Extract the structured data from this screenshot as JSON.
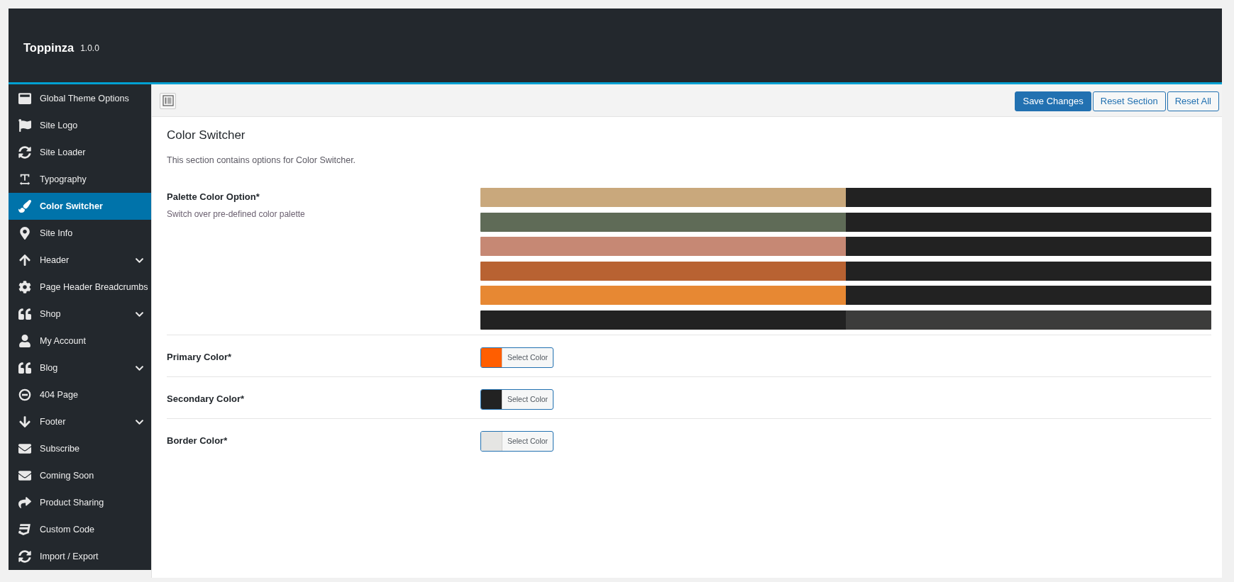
{
  "header": {
    "title": "Toppinza",
    "version": "1.0.0"
  },
  "sidebar": {
    "items": [
      {
        "label": "Global Theme Options",
        "selected": false,
        "submenu": false
      },
      {
        "label": "Site Logo",
        "selected": false,
        "submenu": false
      },
      {
        "label": "Site Loader",
        "selected": false,
        "submenu": false
      },
      {
        "label": "Typography",
        "selected": false,
        "submenu": false
      },
      {
        "label": "Color Switcher",
        "selected": true,
        "submenu": false
      },
      {
        "label": "Site Info",
        "selected": false,
        "submenu": false
      },
      {
        "label": "Header",
        "selected": false,
        "submenu": true
      },
      {
        "label": "Page Header Breadcrumbs",
        "selected": false,
        "submenu": false
      },
      {
        "label": "Shop",
        "selected": false,
        "submenu": true
      },
      {
        "label": "My Account",
        "selected": false,
        "submenu": false
      },
      {
        "label": "Blog",
        "selected": false,
        "submenu": true
      },
      {
        "label": "404 Page",
        "selected": false,
        "submenu": false
      },
      {
        "label": "Footer",
        "selected": false,
        "submenu": true
      },
      {
        "label": "Subscribe",
        "selected": false,
        "submenu": false
      },
      {
        "label": "Coming Soon",
        "selected": false,
        "submenu": false
      },
      {
        "label": "Product Sharing",
        "selected": false,
        "submenu": false
      },
      {
        "label": "Custom Code",
        "selected": false,
        "submenu": false
      },
      {
        "label": "Import / Export",
        "selected": false,
        "submenu": false
      }
    ]
  },
  "toolbar": {
    "buttons": [
      {
        "label": "Save Changes",
        "kind": "primary"
      },
      {
        "label": "Reset Section",
        "kind": "secondary"
      },
      {
        "label": "Reset All",
        "kind": "secondary"
      }
    ]
  },
  "section": {
    "title": "Color Switcher",
    "description": "This section contains options for Color Switcher."
  },
  "fields": [
    {
      "kind": "palette",
      "label": "Palette Color Option*",
      "description": "Switch over pre-defined color palette",
      "options": [
        {
          "swatches": [
            {
              "color": "#c9a87c"
            },
            {
              "color": "#222222"
            }
          ]
        },
        {
          "swatches": [
            {
              "color": "#5f6b57"
            },
            {
              "color": "#222222"
            }
          ]
        },
        {
          "swatches": [
            {
              "color": "#c68874"
            },
            {
              "color": "#222222"
            }
          ]
        },
        {
          "swatches": [
            {
              "color": "#b86232"
            },
            {
              "color": "#222222"
            }
          ]
        },
        {
          "swatches": [
            {
              "color": "#e78833"
            },
            {
              "color": "#222222"
            }
          ]
        },
        {
          "swatches": [
            {
              "color": "#222222"
            },
            {
              "color": "#3c3c3b"
            }
          ]
        }
      ]
    },
    {
      "kind": "color",
      "label": "Primary Color*",
      "color": "#ff5e00",
      "button": "Select Color"
    },
    {
      "kind": "color",
      "label": "Secondary Color*",
      "color": "#222222",
      "button": "Select Color"
    },
    {
      "kind": "color",
      "label": "Border Color*",
      "color": "#e5e5e3",
      "button": "Select Color"
    }
  ]
}
